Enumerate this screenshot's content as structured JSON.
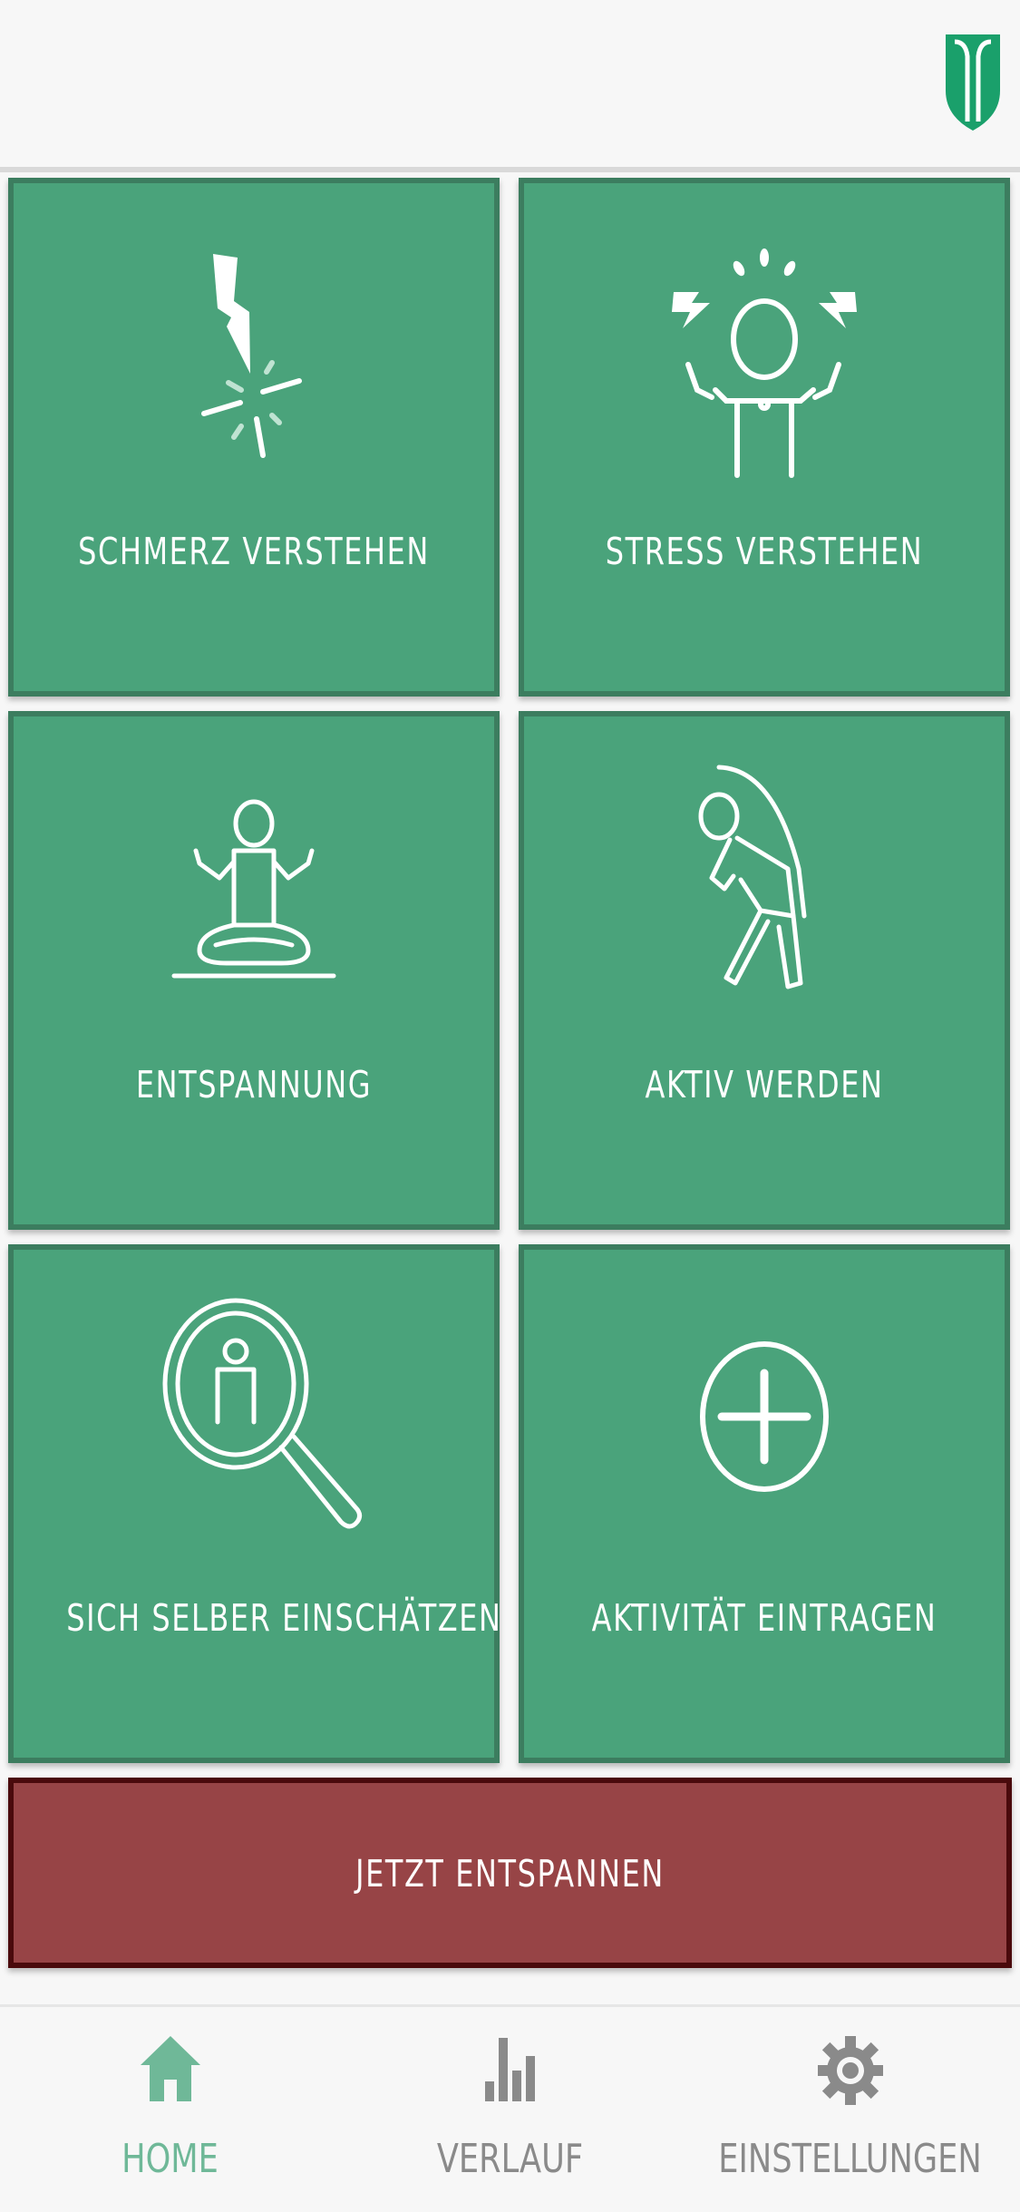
{
  "header": {
    "logo_icon": "university-logo-icon",
    "brand_color": "#1aa06b"
  },
  "tiles": [
    {
      "label": "SCHMERZ VERSTEHEN",
      "icon": "pain-lightning-icon"
    },
    {
      "label": "STRESS VERSTEHEN",
      "icon": "stressed-person-icon"
    },
    {
      "label": "ENTSPANNUNG",
      "icon": "meditation-icon"
    },
    {
      "label": "AKTIV WERDEN",
      "icon": "stretching-person-icon"
    },
    {
      "label": "SICH SELBER EINSCHÄTZEN",
      "icon": "self-assessment-magnifier-icon"
    },
    {
      "label": "AKTIVITÄT EINTRAGEN",
      "icon": "add-circle-icon"
    }
  ],
  "cta": {
    "label": "JETZT ENTSPANNEN"
  },
  "tabbar": {
    "items": [
      {
        "label": "HOME",
        "icon": "home-icon",
        "active": true
      },
      {
        "label": "VERLAUF",
        "icon": "bar-chart-icon",
        "active": false
      },
      {
        "label": "EINSTELLUNGEN",
        "icon": "gear-icon",
        "active": false
      }
    ]
  },
  "colors": {
    "tile_green": "#4aa37b",
    "tile_border": "#3c7d5f",
    "cta_red": "#974446",
    "cta_border": "#4a0a0c",
    "active_tab": "#6fb898",
    "inactive_tab": "#8a8a8a"
  }
}
